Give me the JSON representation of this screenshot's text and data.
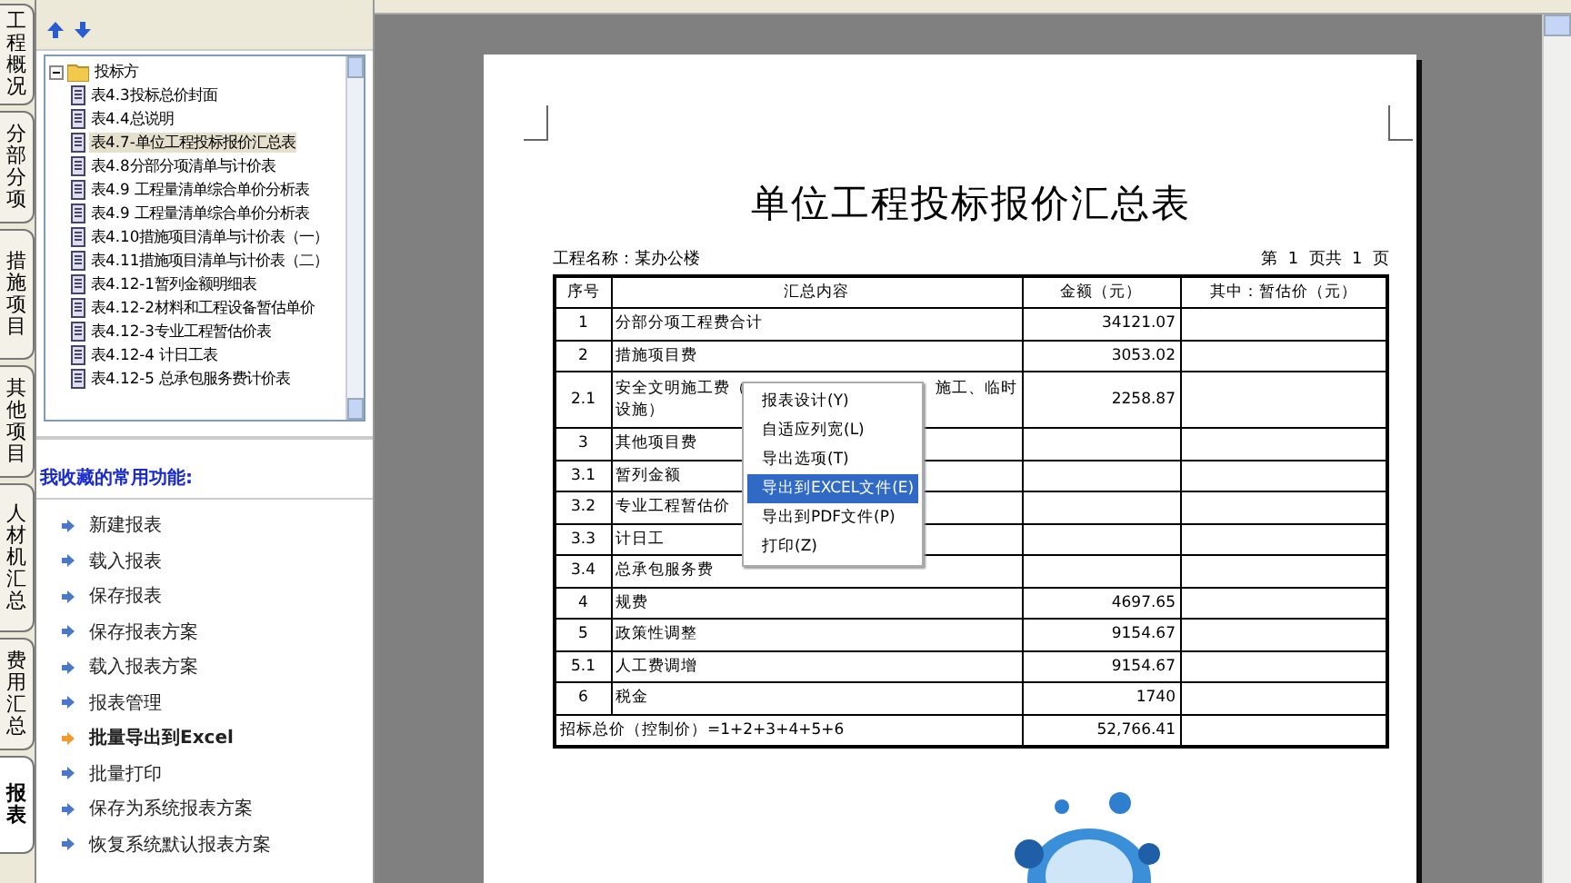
{
  "side_tabs": [
    {
      "label": "工程概况",
      "selected": false
    },
    {
      "label": "分部分项",
      "selected": false
    },
    {
      "label": "措施项目",
      "selected": false
    },
    {
      "label": "其他项目",
      "selected": false
    },
    {
      "label": "人材机汇总",
      "selected": false
    },
    {
      "label": "费用汇总",
      "selected": false
    },
    {
      "label": "报表",
      "selected": true
    }
  ],
  "tree": {
    "label": "投标方",
    "expanded": true,
    "children": [
      {
        "label": "表4.3投标总价封面",
        "selected": false
      },
      {
        "label": "表4.4总说明",
        "selected": false
      },
      {
        "label": "表4.7-单位工程投标报价汇总表",
        "selected": true
      },
      {
        "label": "表4.8分部分项清单与计价表",
        "selected": false
      },
      {
        "label": "表4.9 工程量清单综合单价分析表",
        "selected": false
      },
      {
        "label": "表4.9 工程量清单综合单价分析表",
        "selected": false
      },
      {
        "label": "表4.10措施项目清单与计价表（一）",
        "selected": false
      },
      {
        "label": "表4.11措施项目清单与计价表（二）",
        "selected": false
      },
      {
        "label": "表4.12-1暂列金额明细表",
        "selected": false
      },
      {
        "label": "表4.12-2材料和工程设备暂估单价",
        "selected": false
      },
      {
        "label": "表4.12-3专业工程暂估价表",
        "selected": false
      },
      {
        "label": "表4.12-4 计日工表",
        "selected": false
      },
      {
        "label": "表4.12-5 总承包服务费计价表",
        "selected": false
      }
    ]
  },
  "favorites": {
    "title": "我收藏的常用功能:",
    "items": [
      {
        "label": "新建报表",
        "active": false
      },
      {
        "label": "载入报表",
        "active": false
      },
      {
        "label": "保存报表",
        "active": false
      },
      {
        "label": "保存报表方案",
        "active": false
      },
      {
        "label": "载入报表方案",
        "active": false
      },
      {
        "label": "报表管理",
        "active": false
      },
      {
        "label": "批量导出到Excel",
        "active": true
      },
      {
        "label": "批量打印",
        "active": false
      },
      {
        "label": "保存为系统报表方案",
        "active": false
      },
      {
        "label": "恢复系统默认报表方案",
        "active": false
      }
    ]
  },
  "report": {
    "title": "单位工程投标报价汇总表",
    "project": "工程名称：某办公楼",
    "page_info": "第  1  页共  1  页",
    "columns": [
      "序号",
      "汇总内容",
      "金额（元）",
      "其中：暂估价（元）"
    ],
    "rows": [
      {
        "no": "1",
        "content": "分部分项工程费合计",
        "amount": "34121.07"
      },
      {
        "no": "2",
        "content": "措施项目费",
        "amount": "3053.02"
      },
      {
        "no": "2.1",
        "content": "安全文明施工费（",
        "content_right": "施工、临时",
        "content_line2": "设施）",
        "amount": "2258.87"
      },
      {
        "no": "3",
        "content": "其他项目费",
        "amount": ""
      },
      {
        "no": "3.1",
        "content": "暂列金额",
        "amount": ""
      },
      {
        "no": "3.2",
        "content": "专业工程暂估价",
        "amount": ""
      },
      {
        "no": "3.3",
        "content": "计日工",
        "amount": ""
      },
      {
        "no": "3.4",
        "content": "总承包服务费",
        "amount": ""
      },
      {
        "no": "4",
        "content": "规费",
        "amount": "4697.65"
      },
      {
        "no": "5",
        "content": "政策性调整",
        "amount": "9154.67"
      },
      {
        "no": "5.1",
        "content": "人工费调增",
        "amount": "9154.67"
      },
      {
        "no": "6",
        "content": "税金",
        "amount": "1740"
      }
    ],
    "total": {
      "label": "招标总价（控制价）=1+2+3+4+5+6",
      "amount": "52,766.41"
    }
  },
  "context_menu": [
    {
      "label": "报表设计(Y)",
      "selected": false
    },
    {
      "label": "自适应列宽(L)",
      "selected": false
    },
    {
      "label": "导出选项(T)",
      "selected": false
    },
    {
      "label": "导出到EXCEL文件(E)",
      "selected": true
    },
    {
      "label": "导出到PDF文件(P)",
      "selected": false
    },
    {
      "label": "打印(Z)",
      "selected": false
    }
  ]
}
